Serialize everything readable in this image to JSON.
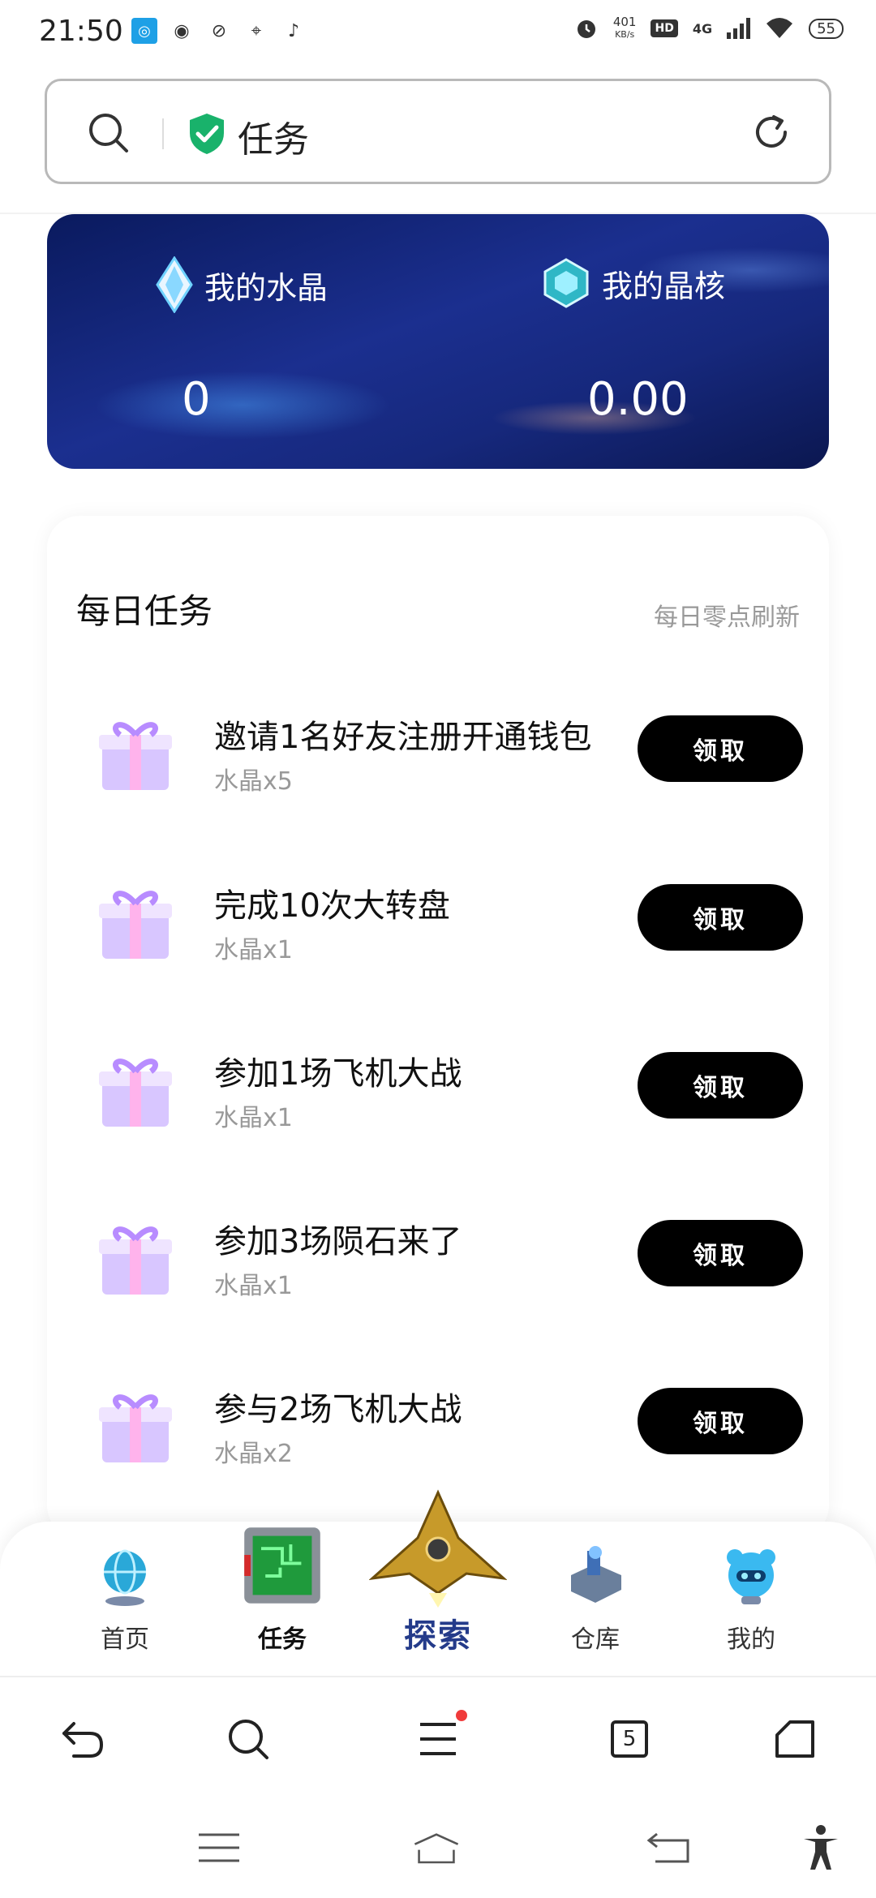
{
  "status_bar": {
    "time": "21:50",
    "net_speed_value": "401",
    "net_speed_unit": "KB/s",
    "hd_badge": "HD",
    "network_type": "4G",
    "battery": "55"
  },
  "search": {
    "text": "任务"
  },
  "banner": {
    "crystal_label": "我的水晶",
    "crystal_value": "0",
    "core_label": "我的晶核",
    "core_value": "0.00"
  },
  "tasks": {
    "title": "每日任务",
    "refresh_note": "每日零点刷新",
    "items": [
      {
        "name": "邀请1名好友注册开通钱包",
        "reward": "水晶x5",
        "button": "领取"
      },
      {
        "name": "完成10次大转盘",
        "reward": "水晶x1",
        "button": "领取"
      },
      {
        "name": "参加1场飞机大战",
        "reward": "水晶x1",
        "button": "领取"
      },
      {
        "name": "参加3场陨石来了",
        "reward": "水晶x1",
        "button": "领取"
      },
      {
        "name": "参与2场飞机大战",
        "reward": "水晶x2",
        "button": "领取"
      }
    ]
  },
  "nav": {
    "home": "首页",
    "tasks": "任务",
    "explore": "探索",
    "warehouse": "仓库",
    "mine": "我的"
  },
  "browser": {
    "tab_count": "5"
  },
  "colors": {
    "banner_bg": "#1b2f8f",
    "button_bg": "#000000",
    "accent_green": "#19b26b",
    "notification_dot": "#f03b3b"
  }
}
